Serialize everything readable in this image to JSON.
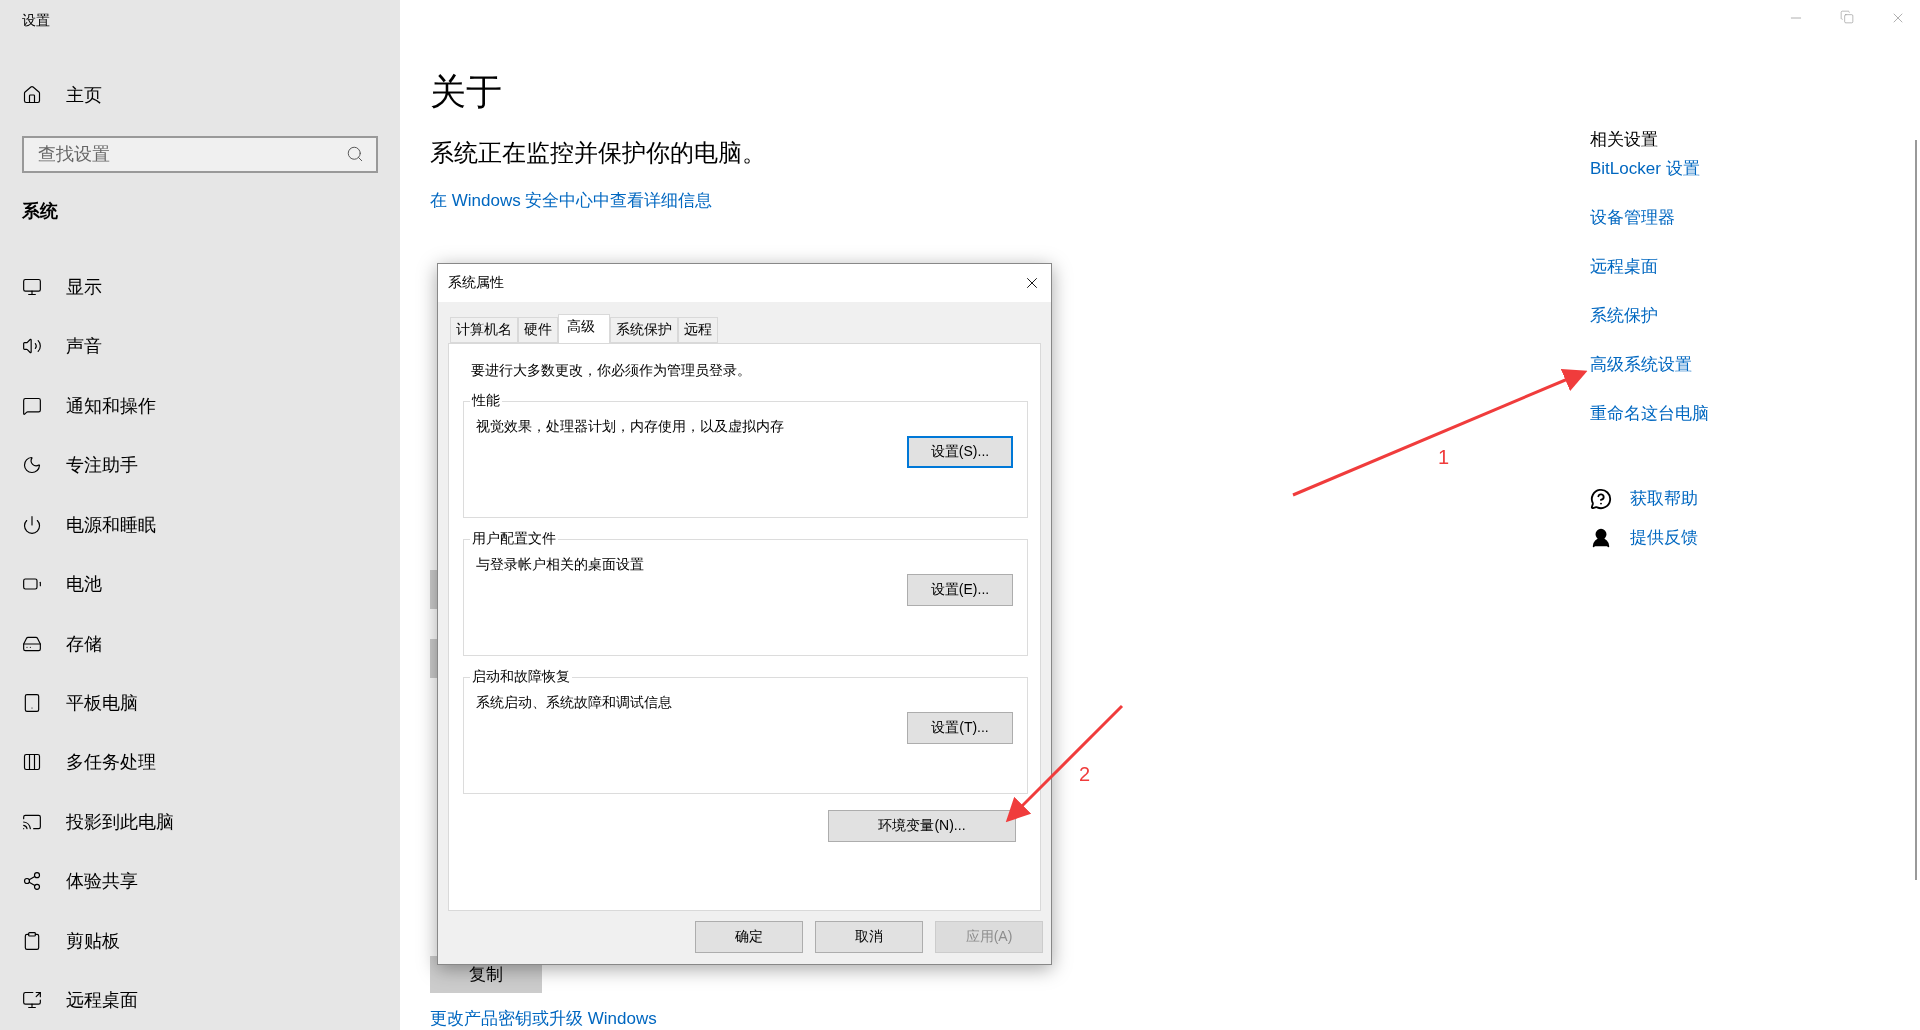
{
  "window": {
    "title": "设置"
  },
  "sidebar": {
    "home": "主页",
    "search": {
      "placeholder": "查找设置"
    },
    "section": "系统",
    "items": [
      {
        "label": "显示"
      },
      {
        "label": "声音"
      },
      {
        "label": "通知和操作"
      },
      {
        "label": "专注助手"
      },
      {
        "label": "电源和睡眠"
      },
      {
        "label": "电池"
      },
      {
        "label": "存储"
      },
      {
        "label": "平板电脑"
      },
      {
        "label": "多任务处理"
      },
      {
        "label": "投影到此电脑"
      },
      {
        "label": "体验共享"
      },
      {
        "label": "剪贴板"
      },
      {
        "label": "远程桌面"
      }
    ]
  },
  "page": {
    "title": "关于",
    "status": "系统正在监控并保护你的电脑。",
    "security_link": "在 Windows 安全中心中查看详细信息",
    "copy_button": "复制",
    "bottom_link": "更改产品密钥或升级 Windows"
  },
  "related": {
    "title": "相关设置",
    "links": [
      "BitLocker 设置",
      "设备管理器",
      "远程桌面",
      "系统保护",
      "高级系统设置",
      "重命名这台电脑"
    ],
    "help": "获取帮助",
    "feedback": "提供反馈"
  },
  "dialog": {
    "title": "系统属性",
    "tabs": [
      {
        "label": "计算机名",
        "selected": false
      },
      {
        "label": "硬件",
        "selected": false
      },
      {
        "label": "高级",
        "selected": true
      },
      {
        "label": "系统保护",
        "selected": false
      },
      {
        "label": "远程",
        "selected": false
      }
    ],
    "notice": "要进行大多数更改，你必须作为管理员登录。",
    "groups": [
      {
        "title": "性能",
        "description": "视觉效果，处理器计划，内存使用，以及虚拟内存",
        "button": "设置(S)...",
        "focused": true
      },
      {
        "title": "用户配置文件",
        "description": "与登录帐户相关的桌面设置",
        "button": "设置(E)...",
        "focused": false
      },
      {
        "title": "启动和故障恢复",
        "description": "系统启动、系统故障和调试信息",
        "button": "设置(T)...",
        "focused": false
      }
    ],
    "env_button": "环境变量(N)...",
    "footer": [
      {
        "label": "确定",
        "disabled": false
      },
      {
        "label": "取消",
        "disabled": false
      },
      {
        "label": "应用(A)",
        "disabled": true
      }
    ]
  },
  "annotations": [
    {
      "label": "1"
    },
    {
      "label": "2"
    }
  ]
}
